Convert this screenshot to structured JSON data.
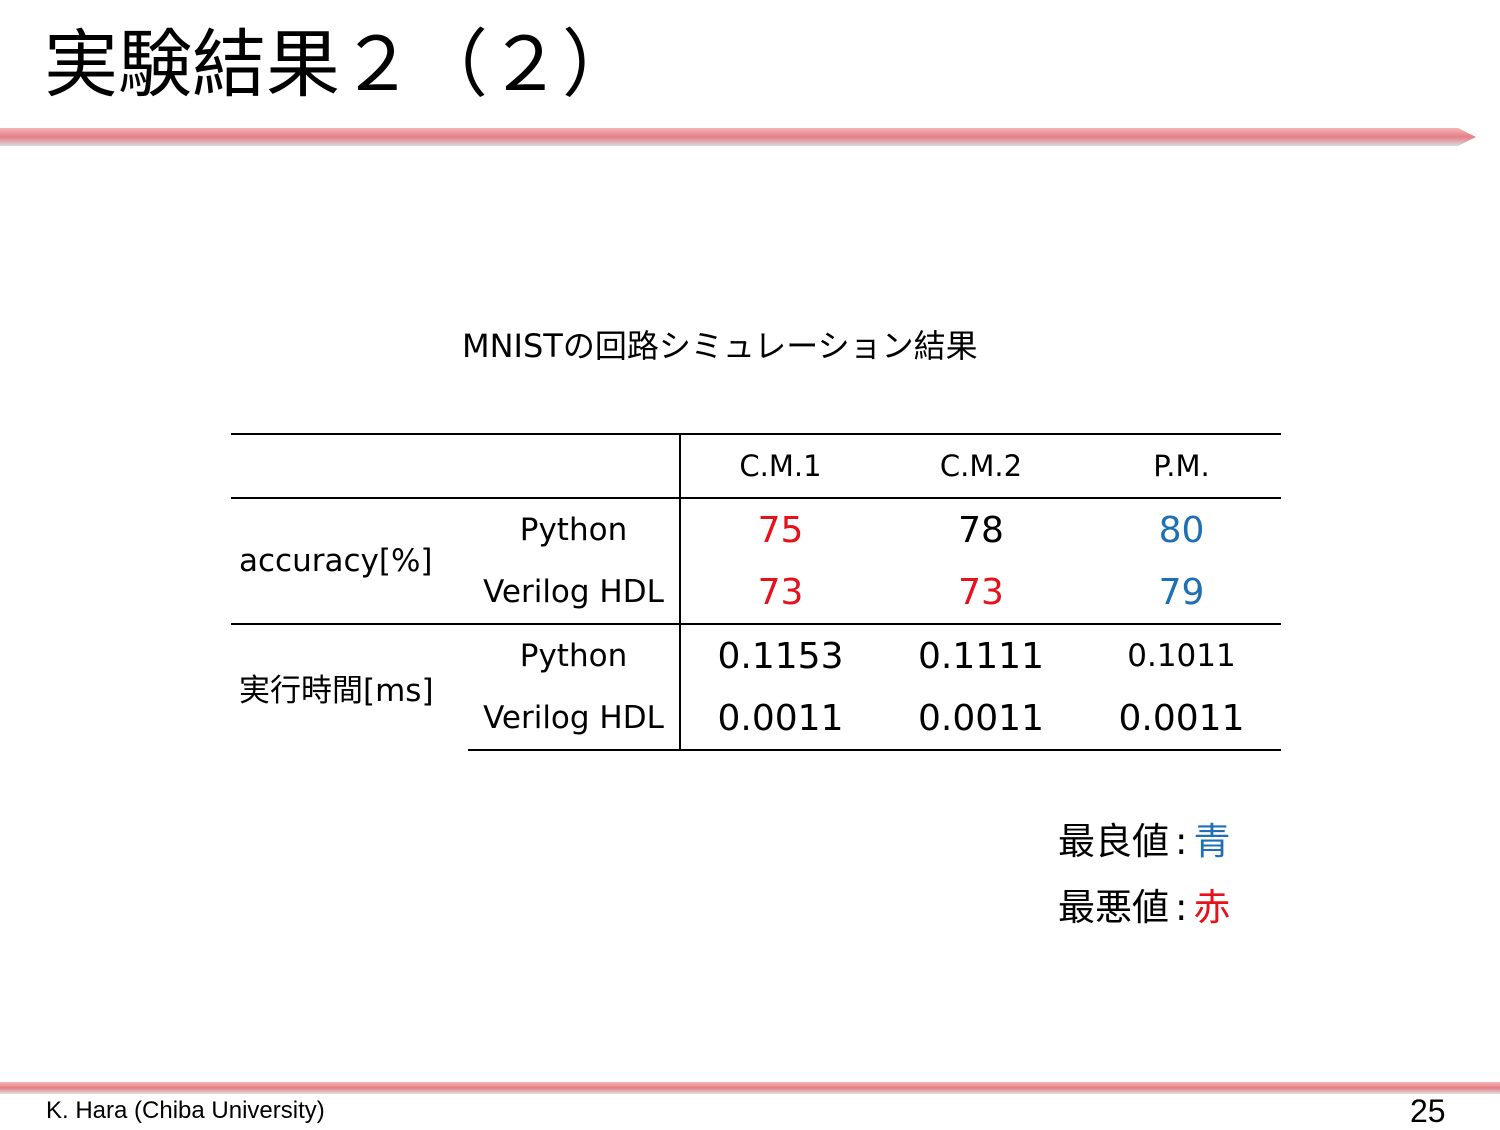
{
  "slide": {
    "title": "実験結果２（２）",
    "footer": "K. Hara (Chiba University)",
    "page_number": "25"
  },
  "table": {
    "caption": "MNISTの回路シミュレーション結果",
    "columns": [
      "",
      "",
      "C.M.1",
      "C.M.2",
      "P.M."
    ],
    "groups": [
      {
        "label": "accuracy[%]",
        "rows": [
          {
            "lang": "Python",
            "values": [
              "75",
              "78",
              "80"
            ]
          },
          {
            "lang": "Verilog HDL",
            "values": [
              "73",
              "73",
              "79"
            ]
          }
        ]
      },
      {
        "label": "実行時間[ms]",
        "rows": [
          {
            "lang": "Python",
            "values": [
              "0.1153",
              "0.1111",
              "0.1011"
            ]
          },
          {
            "lang": "Verilog HDL",
            "values": [
              "0.0011",
              "0.0011",
              "0.0011"
            ]
          }
        ]
      }
    ]
  },
  "legend": {
    "best": {
      "label": "最良値",
      "separator": ":",
      "value": "青"
    },
    "worst": {
      "label": "最悪値",
      "separator": ":",
      "value": "赤"
    }
  },
  "colors": {
    "best": "#1f6fb5",
    "worst": "#e8111b",
    "rule": "#e57f86"
  }
}
